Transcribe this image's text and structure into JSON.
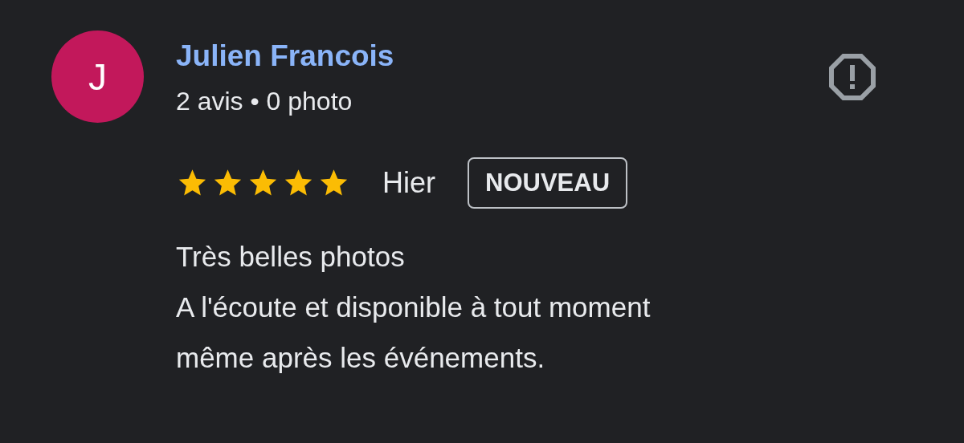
{
  "review": {
    "avatar_letter": "J",
    "author": "Julien Francois",
    "meta": "2 avis • 0 photo",
    "stars": 5,
    "date": "Hier",
    "badge": "NOUVEAU",
    "text_lines": [
      "Très belles photos",
      "A l'écoute et disponible à tout moment",
      "même après les événements."
    ]
  }
}
